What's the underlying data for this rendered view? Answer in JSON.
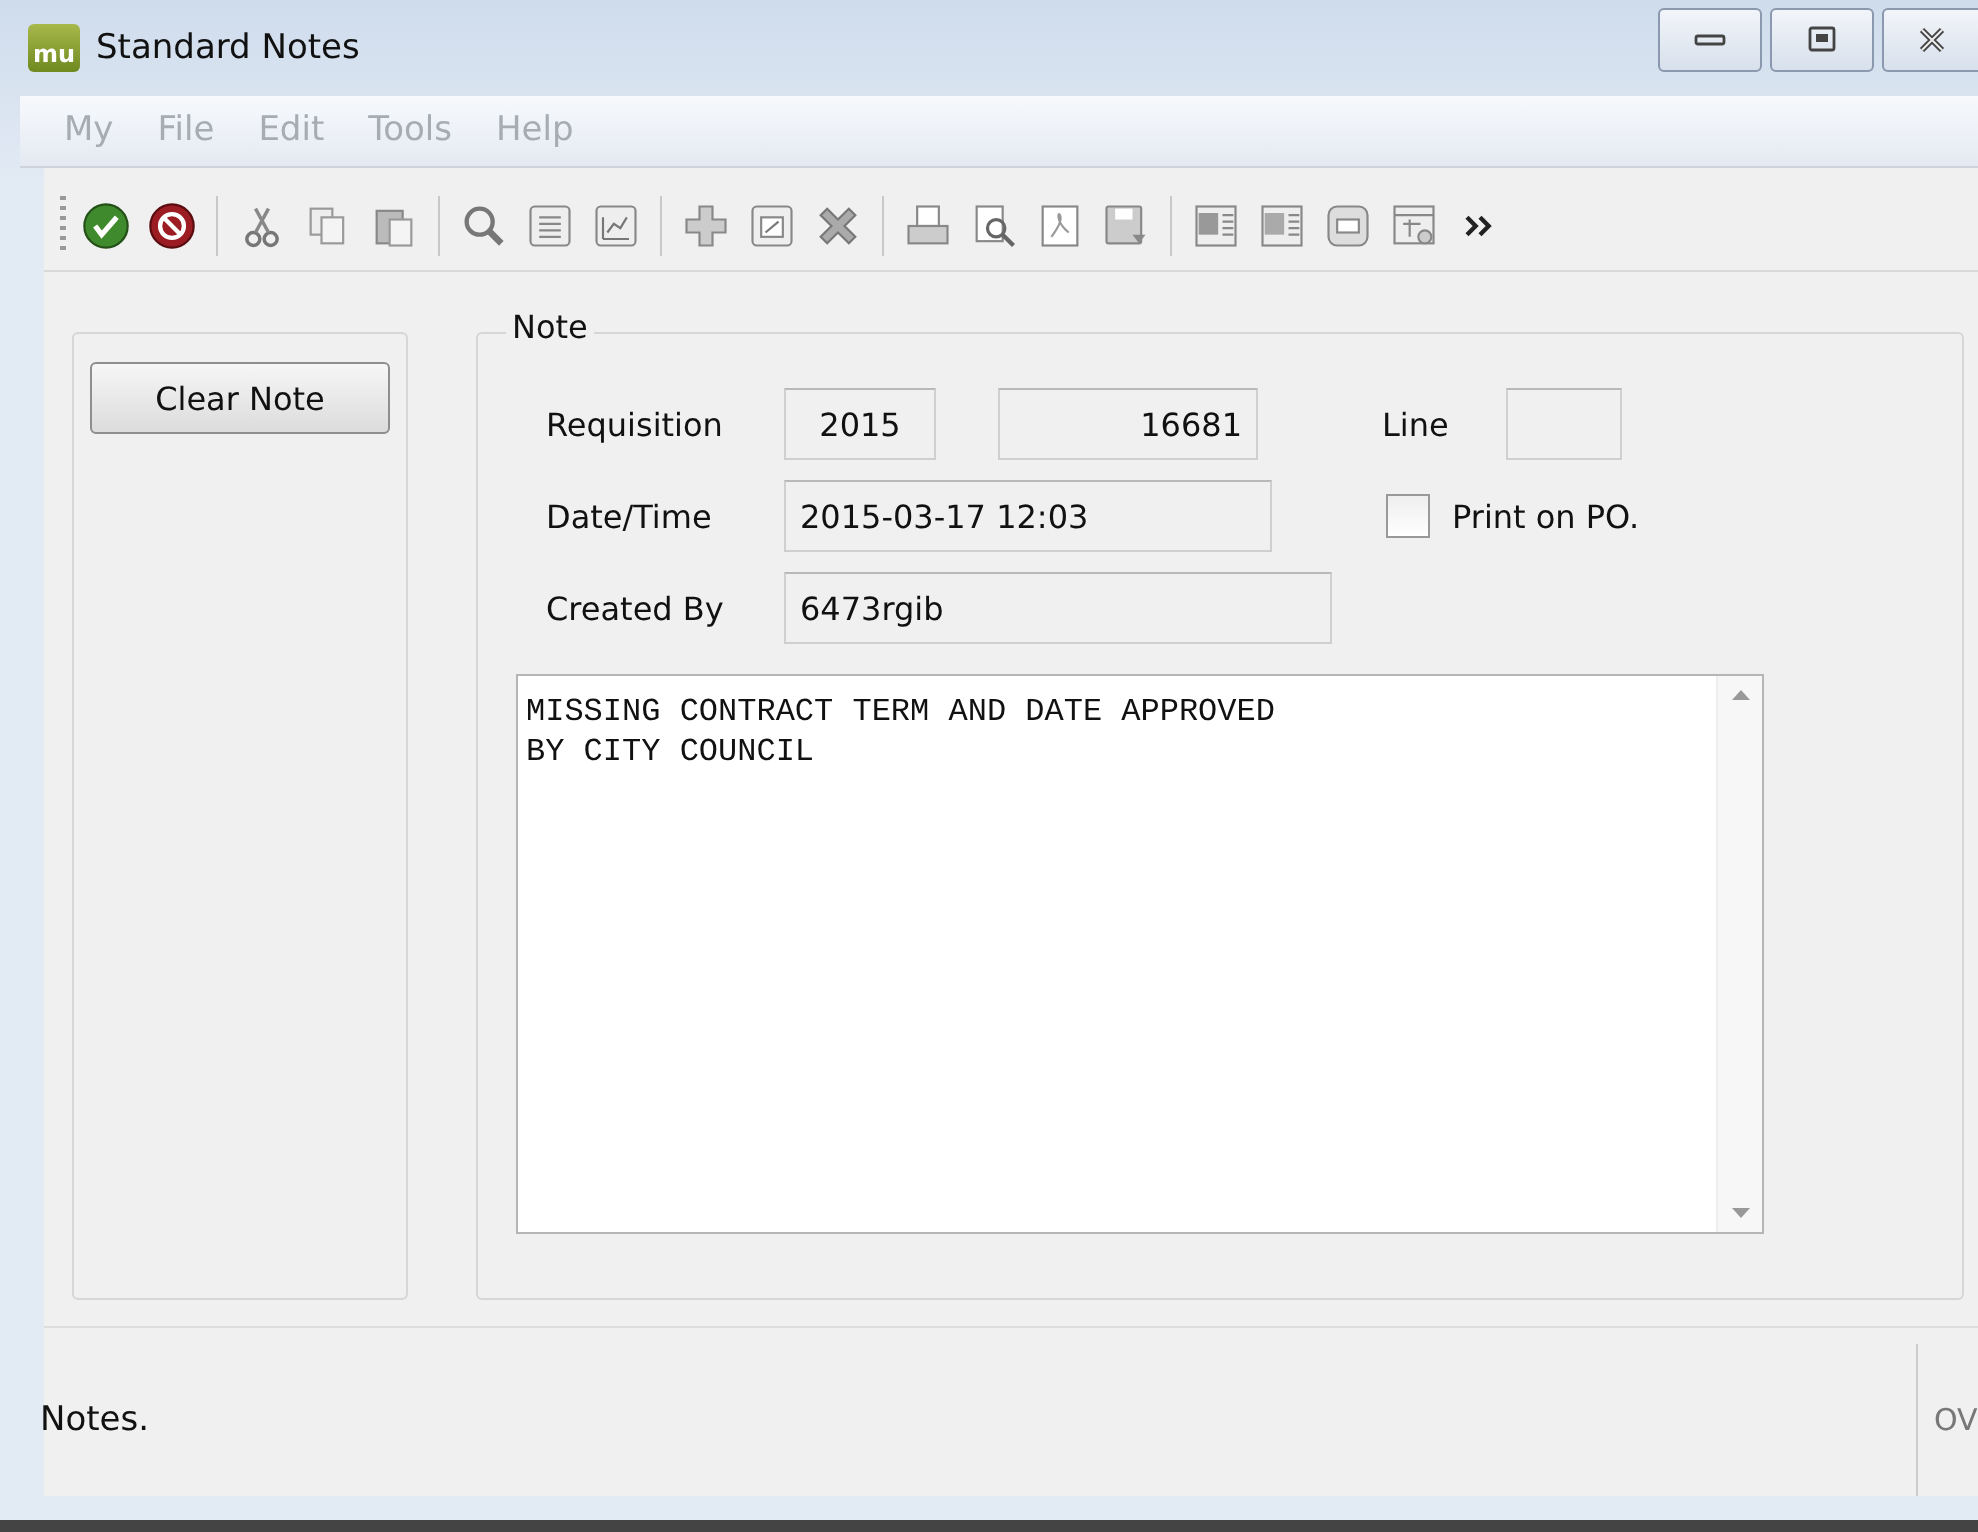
{
  "window": {
    "title": "Standard Notes",
    "logo": "mu"
  },
  "menu": [
    {
      "label": "My",
      "disabled": true
    },
    {
      "label": "File",
      "disabled": true
    },
    {
      "label": "Edit",
      "disabled": true
    },
    {
      "label": "Tools",
      "disabled": true
    },
    {
      "label": "Help",
      "disabled": true
    }
  ],
  "side_button": "Clear Note",
  "note": {
    "legend": "Note",
    "requisition": {
      "label": "Requisition",
      "year": "2015",
      "number": "16681"
    },
    "line": {
      "label": "Line"
    },
    "date_time": {
      "label": "Date/Time",
      "value": "2015-03-17 12:03"
    },
    "print_on_po": {
      "label": "Print on PO.",
      "checked": false
    },
    "created_by": {
      "label": "Created By",
      "value": "6473rgib"
    },
    "text": "MISSING CONTRACT TERM AND DATE APPROVED\nBY CITY COUNCIL"
  },
  "status_bar": {
    "message": "Notes.",
    "mode": "OV"
  }
}
